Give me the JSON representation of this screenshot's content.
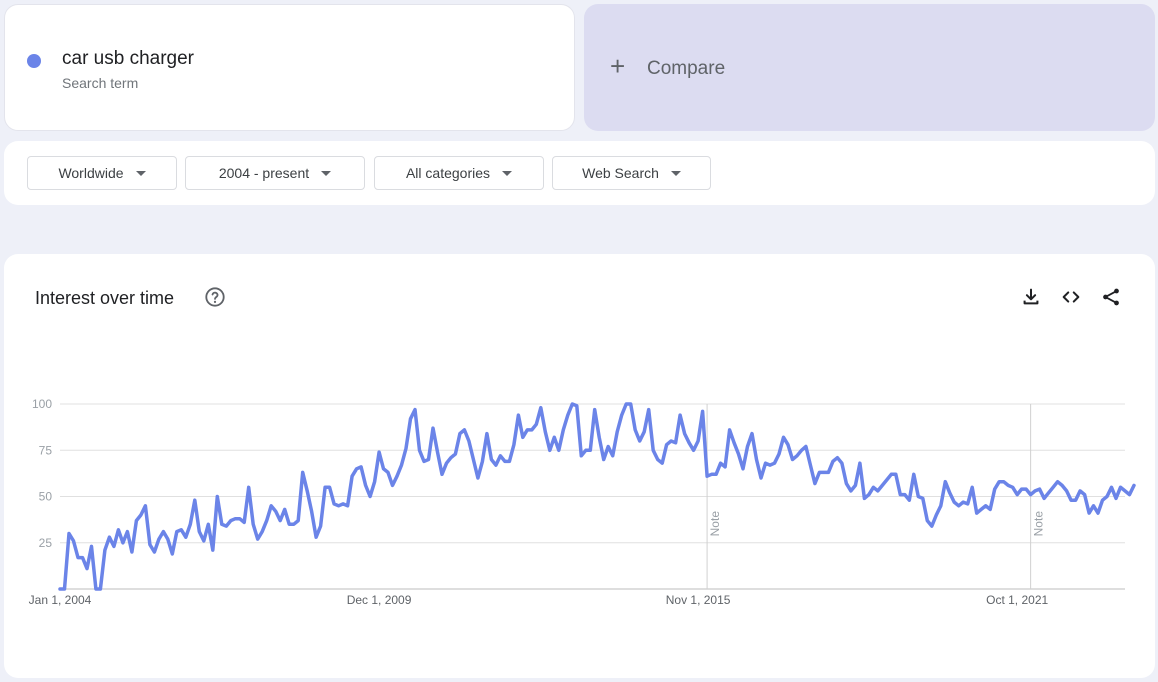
{
  "search_term": {
    "name": "car usb charger",
    "subtitle": "Search term",
    "color": "#6b84e8"
  },
  "compare": {
    "label": "Compare"
  },
  "filters": [
    {
      "label": "Worldwide"
    },
    {
      "label": "2004 - present"
    },
    {
      "label": "All categories"
    },
    {
      "label": "Web Search"
    }
  ],
  "chart_card": {
    "title": "Interest over time"
  },
  "chart_data": {
    "type": "line",
    "x_start": "2004-01",
    "x_end": "2023-10",
    "x_step": "month",
    "ylim": [
      0,
      100
    ],
    "yticks": [
      25,
      50,
      75,
      100
    ],
    "xticks": [
      {
        "label": "Jan 1, 2004",
        "date": "2004-01"
      },
      {
        "label": "Dec 1, 2009",
        "date": "2009-12"
      },
      {
        "label": "Nov 1, 2015",
        "date": "2015-11"
      },
      {
        "label": "Oct 1, 2021",
        "date": "2021-10"
      }
    ],
    "notes": [
      {
        "label": "Note",
        "date": "2016-01"
      },
      {
        "label": "Note",
        "date": "2022-01"
      }
    ],
    "line_color": "#6b84e8",
    "grid": true,
    "series": [
      {
        "values": [
          0,
          0,
          30,
          26,
          17,
          17,
          11,
          23,
          0,
          0,
          21,
          28,
          23,
          32,
          25,
          31,
          20,
          37,
          40,
          45,
          24,
          20,
          27,
          31,
          27,
          19,
          31,
          32,
          28,
          35,
          48,
          31,
          26,
          35,
          21,
          50,
          35,
          34,
          37,
          38,
          38,
          36,
          55,
          35,
          27,
          31,
          37,
          45,
          42,
          37,
          43,
          35,
          35,
          37,
          63,
          53,
          42,
          28,
          34,
          55,
          55,
          46,
          45,
          46,
          45,
          61,
          65,
          66,
          56,
          50,
          58,
          74,
          65,
          63,
          56,
          61,
          67,
          76,
          92,
          97,
          75,
          69,
          70,
          87,
          74,
          62,
          68,
          71,
          73,
          84,
          86,
          80,
          70,
          60,
          69,
          84,
          70,
          67,
          72,
          69,
          69,
          78,
          94,
          82,
          86,
          86,
          89,
          98,
          85,
          75,
          82,
          75,
          86,
          94,
          100,
          99,
          72,
          75,
          75,
          97,
          82,
          70,
          77,
          72,
          85,
          94,
          100,
          100,
          86,
          80,
          85,
          97,
          75,
          70,
          68,
          78,
          80,
          79,
          94,
          84,
          79,
          75,
          80,
          96,
          61,
          62,
          62,
          68,
          66,
          86,
          79,
          73,
          65,
          77,
          84,
          70,
          60,
          68,
          67,
          68,
          73,
          82,
          78,
          70,
          72,
          75,
          77,
          67,
          57,
          63,
          63,
          63,
          69,
          71,
          68,
          57,
          53,
          56,
          68,
          49,
          51,
          55,
          53,
          56,
          59,
          62,
          62,
          51,
          51,
          48,
          62,
          50,
          49,
          37,
          34,
          40,
          45,
          58,
          52,
          47,
          45,
          47,
          46,
          55,
          41,
          43,
          45,
          43,
          54,
          58,
          58,
          56,
          55,
          51,
          54,
          54,
          51,
          53,
          54,
          49,
          52,
          55,
          58,
          56,
          53,
          48,
          48,
          53,
          51,
          41,
          45,
          41,
          48,
          50,
          55,
          49,
          55,
          53,
          51,
          56
        ]
      }
    ]
  }
}
